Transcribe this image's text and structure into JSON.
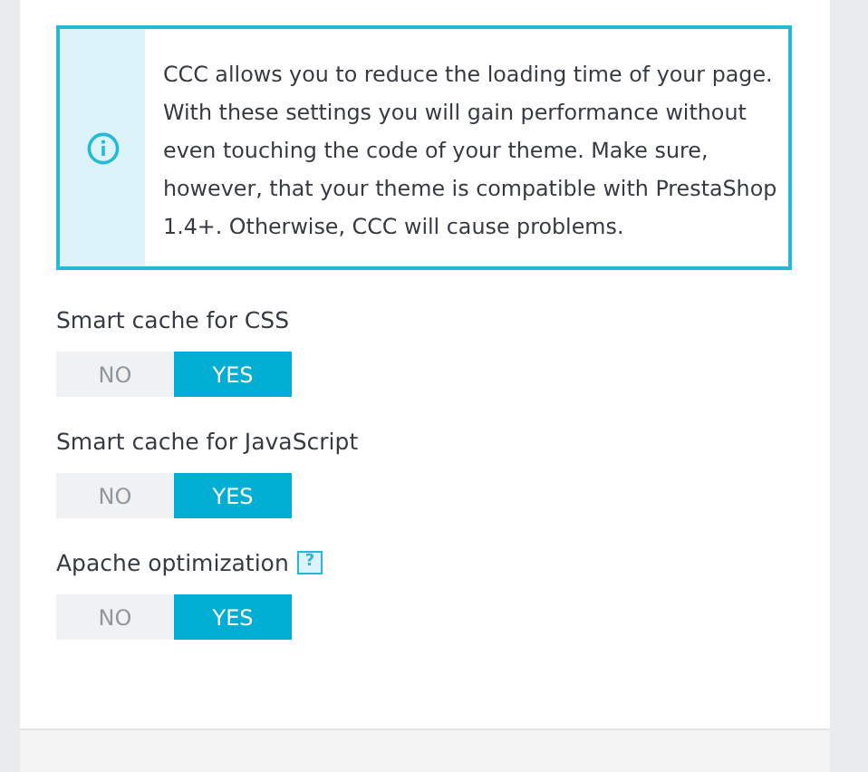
{
  "info_alert": {
    "text": "CCC allows you to reduce the loading time of your page. With these settings you will gain performance without even touching the code of your theme. Make sure, however, that your theme is compatible with PrestaShop 1.4+. Otherwise, CCC will cause problems."
  },
  "settings": [
    {
      "label": "Smart cache for CSS",
      "options": [
        {
          "label": "NO",
          "selected": false
        },
        {
          "label": "YES",
          "selected": true
        }
      ]
    },
    {
      "label": "Smart cache for JavaScript",
      "options": [
        {
          "label": "NO",
          "selected": false
        },
        {
          "label": "YES",
          "selected": true
        }
      ]
    },
    {
      "label": "Apache optimization",
      "help": "?",
      "options": [
        {
          "label": "NO",
          "selected": false
        },
        {
          "label": "YES",
          "selected": true
        }
      ]
    }
  ]
}
